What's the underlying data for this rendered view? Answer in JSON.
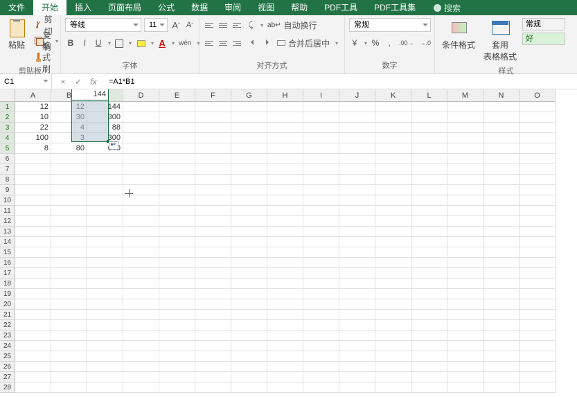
{
  "menu": {
    "tabs": [
      "文件",
      "开始",
      "插入",
      "页面布局",
      "公式",
      "数据",
      "审阅",
      "视图",
      "帮助",
      "PDF工具",
      "PDF工具集"
    ],
    "active": 1,
    "search": "搜索"
  },
  "ribbon": {
    "clipboard": {
      "label": "剪贴板",
      "paste": "粘贴",
      "cut": "剪切",
      "copy": "复制",
      "painter": "格式刷"
    },
    "font": {
      "label": "字体",
      "name": "等线",
      "size": "11",
      "bold": "B",
      "italic": "I",
      "underline": "U"
    },
    "align": {
      "label": "对齐方式",
      "wrap": "自动换行",
      "merge": "合并后居中"
    },
    "number": {
      "label": "数字",
      "format": "常规"
    },
    "styles": {
      "label": "样式",
      "cond": "条件格式",
      "table": "套用\n表格格式",
      "normal": "常规",
      "good": "好"
    }
  },
  "namebox": "C1",
  "formula": "=A1*B1",
  "columns": [
    "A",
    "B",
    "C",
    "D",
    "E",
    "F",
    "G",
    "H",
    "I",
    "J",
    "K",
    "L",
    "M",
    "N",
    "O"
  ],
  "rows": 28,
  "cells": {
    "A": [
      12,
      10,
      22,
      100,
      8
    ],
    "B": [
      12,
      30,
      4,
      3,
      80
    ],
    "C": [
      144,
      300,
      88,
      300,
      640
    ]
  },
  "selected_col": "C",
  "selected_rows": [
    1,
    2,
    3,
    4,
    5
  ]
}
